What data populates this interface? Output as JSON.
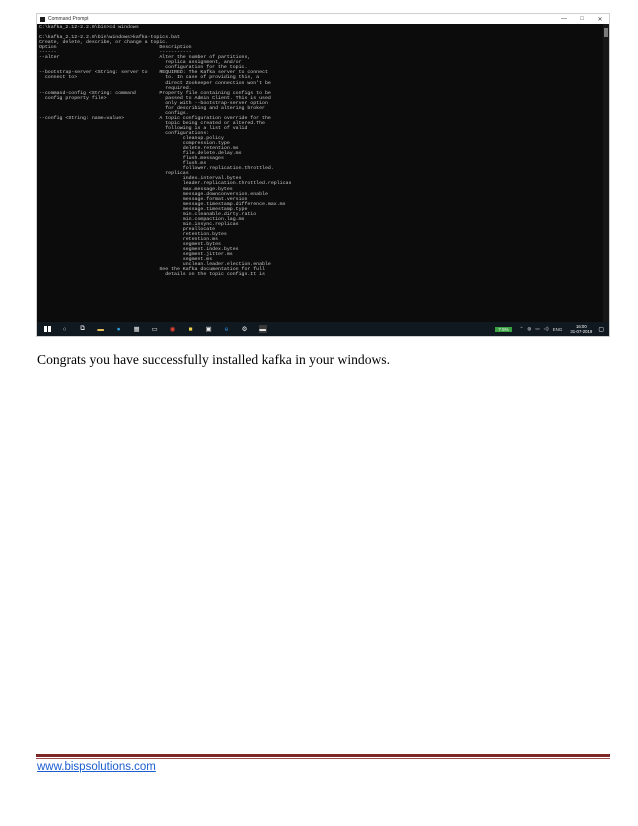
{
  "window": {
    "title": "Command Prompt",
    "controls": [
      "—",
      "□",
      "✕"
    ]
  },
  "console": {
    "lines": [
      "C:\\kafka_2.12-2.2.0\\bin>cd windows",
      "",
      "C:\\kafka_2.12-2.2.0\\bin\\windows>kafka-topics.bat",
      "Create, delete, describe, or change a topic.",
      "Option                                   Description",
      "------                                   -----------",
      "--alter                                  Alter the number of partitions,",
      "                                           replica assignment, and/or",
      "                                           configuration for the topic.",
      "--bootstrap-server <String: server to    REQUIRED: The Kafka server to connect",
      "  connect to>                              to. In case of providing this, a",
      "                                           direct Zookeeper connection won't be",
      "                                           required.",
      "--command-config <String: command        Property file containing configs to be",
      "  config property file>                    passed to Admin Client. This is used",
      "                                           only with --bootstrap-server option",
      "                                           for describing and altering broker",
      "                                           configs.",
      "--config <String: name=value>            A topic configuration override for the",
      "                                           topic being created or altered.The",
      "                                           following is a list of valid",
      "                                           configurations:",
      "                                                 cleanup.policy",
      "                                                 compression.type",
      "                                                 delete.retention.ms",
      "                                                 file.delete.delay.ms",
      "                                                 flush.messages",
      "                                                 flush.ms",
      "                                                 follower.replication.throttled.",
      "                                           replicas",
      "                                                 index.interval.bytes",
      "                                                 leader.replication.throttled.replicas",
      "                                                 max.message.bytes",
      "                                                 message.downconversion.enable",
      "                                                 message.format.version",
      "                                                 message.timestamp.difference.max.ms",
      "                                                 message.timestamp.type",
      "                                                 min.cleanable.dirty.ratio",
      "                                                 min.compaction.lag.ms",
      "                                                 min.insync.replicas",
      "                                                 preallocate",
      "                                                 retention.bytes",
      "                                                 retention.ms",
      "                                                 segment.bytes",
      "                                                 segment.index.bytes",
      "                                                 segment.jitter.ms",
      "                                                 segment.ms",
      "                                                 unclean.leader.election.enable",
      "                                         See the Kafka documentation for full",
      "                                           details on the topic configs.It is"
    ]
  },
  "taskbar": {
    "tray_badge": "7.5%",
    "language": "ENG",
    "time": "16:00",
    "date": "31-07-2019"
  },
  "document": {
    "caption": "Congrats you have successfully installed kafka in your windows.",
    "footer_link": "www.bispsolutions.com"
  }
}
